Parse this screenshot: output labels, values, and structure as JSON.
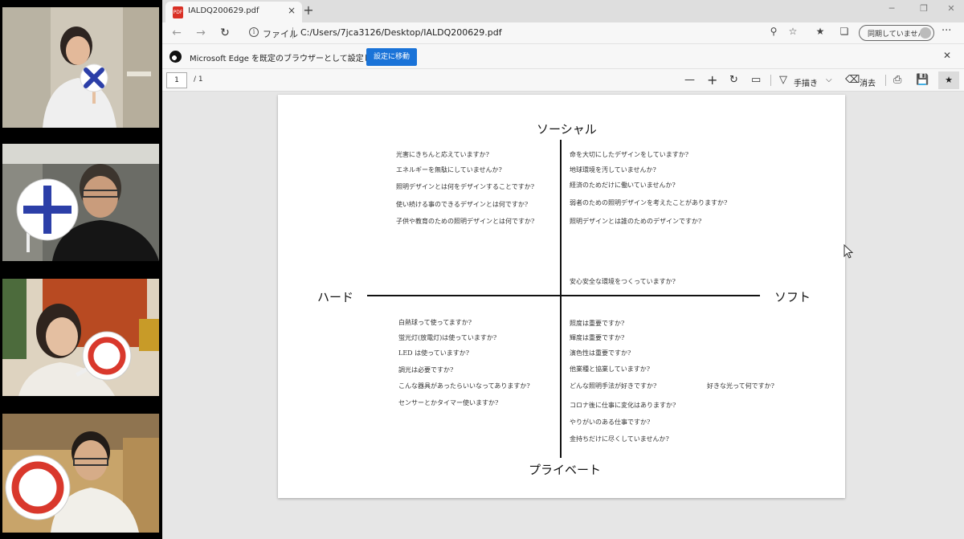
{
  "tab": {
    "title": "IALDQ200629.pdf",
    "close": "×",
    "new_tab": "+",
    "pdf_icon": "PDF"
  },
  "window_controls": {
    "minimize": "─",
    "restore": "❐",
    "close": "✕"
  },
  "address": {
    "info": "i",
    "label": "ファイル",
    "url": "C:/Users/7jca3126/Desktop/IALDQ200629.pdf",
    "sync_label": "同期していません",
    "more": "···"
  },
  "infobar": {
    "message": "Microsoft Edge を既定のブラウザーとして設定しますか?",
    "button": "設定に移動",
    "close": "✕"
  },
  "pdf_toolbar": {
    "page": "1",
    "total": "/ 1",
    "zoom_out": "—",
    "zoom_in": "+",
    "draw_label": "手描き",
    "erase_label": "消去"
  },
  "chart": {
    "top": "ソーシャル",
    "bottom": "プライベート",
    "left": "ハード",
    "right": "ソフト",
    "upper_left": [
      "光害にきちんと応えていますか?",
      "エネルギーを無駄にしていませんか?",
      "照明デザインとは何をデザインすることですか?",
      "使い続ける事のできるデザインとは何ですか?",
      "子供や教育のための照明デザインとは何ですか?"
    ],
    "upper_right": [
      "命を大切にしたデザインをしていますか?",
      "地球環境を汚していませんか?",
      "経済のためだけに働いていませんか?",
      "弱者のための照明デザインを考えたことがありますか?",
      "照明デザインとは誰のためのデザインですか?",
      "安心安全な環境をつくっていますか?"
    ],
    "lower_left": [
      "白熱球って使ってますか?",
      "蛍光灯(放電灯)は使っていますか?",
      "LED は使っていますか?",
      "調光は必要ですか?",
      "こんな器具があったらいいなってありますか?",
      "センサーとかタイマー使いますか?"
    ],
    "lower_right": [
      "照度は重要ですか?",
      "輝度は重要ですか?",
      "演色性は重要ですか?",
      "他業種と協業していますか?",
      "どんな照明手法が好きですか?",
      "コロナ後に仕事に変化はありますか?",
      "やりがいのある仕事ですか?",
      "金持ちだけに尽くしていませんか?"
    ],
    "lower_right_extra": "好きな光って何ですか?"
  },
  "colors": {
    "accent_button": "#1a73d8",
    "pdf_red": "#d93025",
    "cross_blue": "#2c3fa8",
    "circle_red": "#d9382c"
  }
}
